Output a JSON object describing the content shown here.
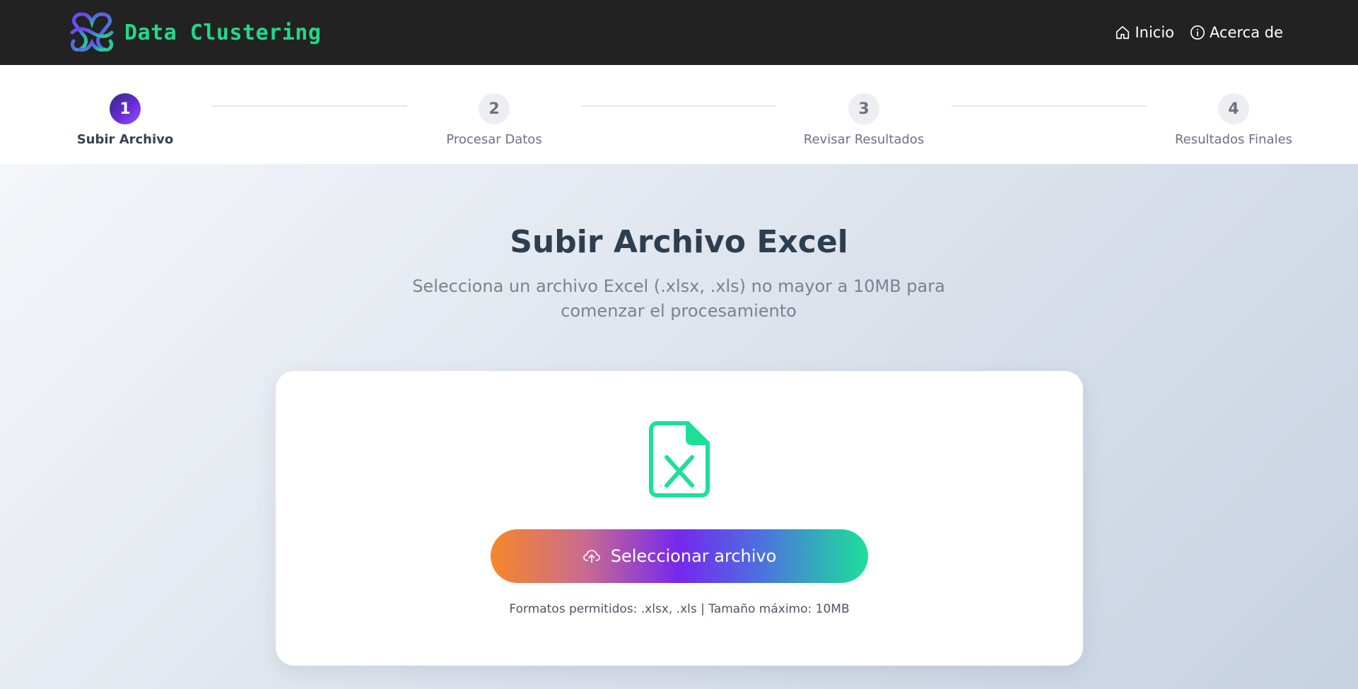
{
  "app": {
    "brand_name": "Data Clustering",
    "brand_colors": {
      "text": "#22d98a",
      "header_bg": "#222222"
    }
  },
  "nav": {
    "items": [
      {
        "label": "Inicio",
        "icon": "home-icon"
      },
      {
        "label": "Acerca de",
        "icon": "info-icon"
      }
    ]
  },
  "stepper": {
    "active_step": 1,
    "steps": [
      {
        "number": "1",
        "label": "Subir Archivo",
        "state": "active"
      },
      {
        "number": "2",
        "label": "Procesar Datos",
        "state": "pending"
      },
      {
        "number": "3",
        "label": "Revisar Resultados",
        "state": "pending"
      },
      {
        "number": "4",
        "label": "Resultados Finales",
        "state": "pending"
      }
    ]
  },
  "main": {
    "title": "Subir Archivo Excel",
    "subtitle": "Selecciona un archivo Excel (.xlsx, .xls) no mayor a 10MB para comenzar el procesamiento"
  },
  "upload": {
    "icon": "excel-file-icon",
    "button_icon": "cloud-upload-icon",
    "button_label": "Seleccionar archivo",
    "hint": "Formatos permitidos: .xlsx, .xls | Tamaño máximo: 10MB",
    "accent_color": "#1de098"
  }
}
